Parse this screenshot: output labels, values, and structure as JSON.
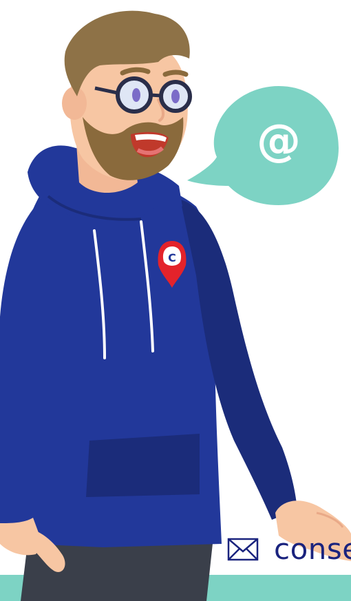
{
  "colors": {
    "teal": "#7dd3c4",
    "hoodie_blue": "#22389a",
    "hoodie_dark": "#1b2c7a",
    "skin": "#f7c6a3",
    "beard": "#8a6a3c",
    "hair": "#8e7247",
    "navy_text": "#1a237e",
    "white": "#ffffff"
  },
  "speech_bubble": {
    "symbol": "@",
    "icon": "at-sign-speech-bubble"
  },
  "badge": {
    "letter": "C",
    "icon": "location-pin-badge"
  },
  "contact": {
    "icon": "mail-icon",
    "text": "conse"
  }
}
